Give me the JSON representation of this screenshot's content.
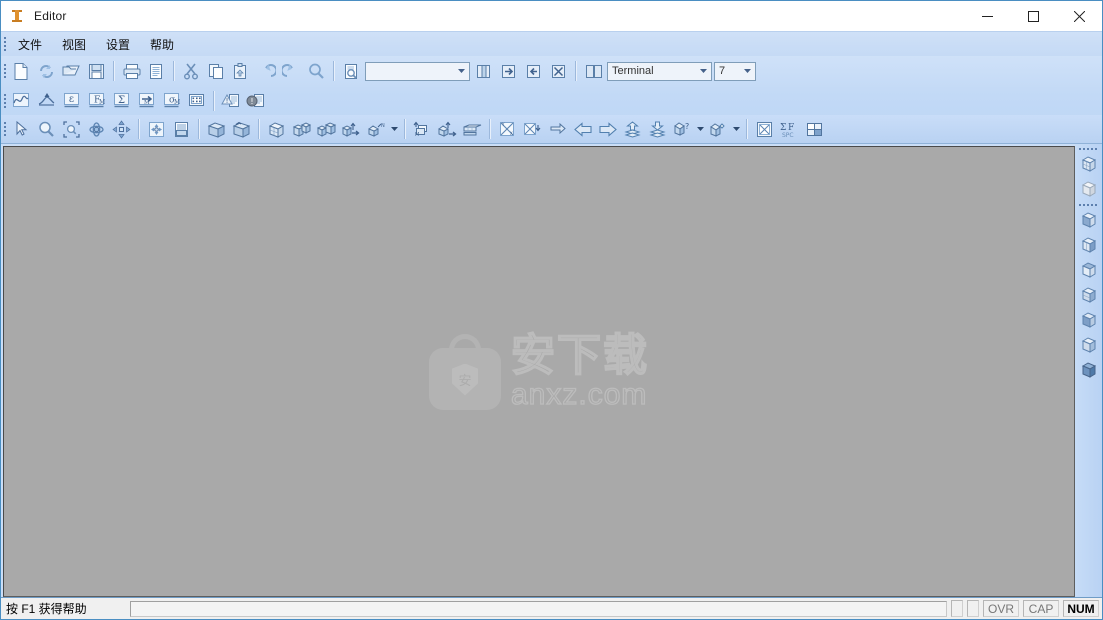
{
  "window": {
    "title": "Editor",
    "icon": "ibeam-icon",
    "controls": {
      "minimize": "minimize-icon",
      "maximize": "maximize-icon",
      "close": "close-icon"
    }
  },
  "menubar": {
    "items": [
      {
        "label": "文件",
        "name": "menu-file"
      },
      {
        "label": "视图",
        "name": "menu-view"
      },
      {
        "label": "设置",
        "name": "menu-settings"
      },
      {
        "label": "帮助",
        "name": "menu-help"
      }
    ]
  },
  "toolbars": {
    "row1": {
      "buttons": [
        {
          "name": "new-file-icon",
          "glyph": "doc"
        },
        {
          "name": "refresh-icon",
          "glyph": "refresh"
        },
        {
          "name": "open-folder-icon",
          "glyph": "folder"
        },
        {
          "name": "save-icon",
          "glyph": "save"
        },
        {
          "name": "print-icon",
          "glyph": "print"
        },
        {
          "name": "print-preview-icon",
          "glyph": "preview"
        },
        {
          "name": "cut-icon",
          "glyph": "cut"
        },
        {
          "name": "copy-icon",
          "glyph": "copy"
        },
        {
          "name": "paste-icon",
          "glyph": "paste"
        },
        {
          "name": "undo-icon",
          "glyph": "undo"
        },
        {
          "name": "redo-icon",
          "glyph": "redo"
        },
        {
          "name": "find-icon",
          "glyph": "find"
        },
        {
          "name": "find-in-file-icon",
          "glyph": "findfile"
        }
      ],
      "combo_blank": {
        "value": "",
        "placeholder": ""
      },
      "nav_buttons": [
        {
          "name": "bookmark-toggle-icon",
          "glyph": "bm1"
        },
        {
          "name": "bookmark-next-icon",
          "glyph": "bm2"
        },
        {
          "name": "bookmark-prev-icon",
          "glyph": "bm3"
        },
        {
          "name": "bookmark-clear-icon",
          "glyph": "bm4"
        }
      ],
      "split_button": {
        "name": "split-window-icon"
      },
      "font_name": "Terminal",
      "font_size": "7"
    },
    "row2": {
      "buttons": [
        {
          "name": "curve-plot-icon",
          "label": ""
        },
        {
          "name": "peak-curve-icon",
          "label": ""
        },
        {
          "name": "epsilon-icon",
          "label": "ε"
        },
        {
          "name": "force-moment-icon",
          "label": "F"
        },
        {
          "name": "sigma-sum-icon",
          "label": "Σ"
        },
        {
          "name": "moment-arrow-icon",
          "label": ""
        },
        {
          "name": "sigma-m-icon",
          "label": "σ"
        },
        {
          "name": "matrix-grid-icon",
          "label": ""
        },
        {
          "name": "warning-report-icon",
          "label": ""
        },
        {
          "name": "error-report-icon",
          "label": ""
        }
      ]
    },
    "row3": {
      "buttons": [
        {
          "name": "select-cursor-icon"
        },
        {
          "name": "zoom-icon"
        },
        {
          "name": "zoom-window-icon"
        },
        {
          "name": "rotate-icon"
        },
        {
          "name": "pan-icon"
        },
        {
          "name": "fit-view-icon"
        },
        {
          "name": "list-view-icon"
        },
        {
          "name": "solid-block-icon"
        },
        {
          "name": "extrude-block-icon"
        },
        {
          "name": "wire-block-icon"
        },
        {
          "name": "mesh-block-icon"
        },
        {
          "name": "assembly-block-icon"
        },
        {
          "name": "move-element-icon"
        },
        {
          "name": "transform-element-icon"
        },
        {
          "name": "group-copy-icon"
        },
        {
          "name": "extrude-arrow-icon"
        },
        {
          "name": "layer-stack-icon"
        },
        {
          "name": "plot-axes-icon"
        },
        {
          "name": "plot-result-icon"
        },
        {
          "name": "export-result-icon"
        },
        {
          "name": "previous-step-icon"
        },
        {
          "name": "next-step-icon"
        },
        {
          "name": "upload-result-icon"
        },
        {
          "name": "download-result-icon"
        },
        {
          "name": "query-entity-icon"
        },
        {
          "name": "create-entity-icon"
        },
        {
          "name": "graph-window-icon"
        },
        {
          "name": "sum-force-spc-icon"
        },
        {
          "name": "split-panel-icon"
        }
      ],
      "carets": [
        "entity-dropdown-caret",
        "create-dropdown-caret"
      ]
    }
  },
  "sidebar": {
    "group1": [
      {
        "name": "sidebar-wire-cube-icon"
      },
      {
        "name": "sidebar-solid-cube-icon"
      }
    ],
    "group2": [
      {
        "name": "sidebar-view-iso-icon"
      },
      {
        "name": "sidebar-view-front-icon"
      },
      {
        "name": "sidebar-view-top-icon"
      },
      {
        "name": "sidebar-view-right-icon"
      },
      {
        "name": "sidebar-view-back-icon"
      },
      {
        "name": "sidebar-view-left-icon"
      },
      {
        "name": "sidebar-view-shaded-icon"
      }
    ]
  },
  "canvas": {
    "watermark": {
      "logo_char": "安",
      "cn_text": "安下载",
      "en_text": "anxz.com"
    },
    "background_color": "#a9a9a9"
  },
  "statusbar": {
    "message": "按 F1 获得帮助",
    "indicators": [
      {
        "label": "OVR",
        "name": "status-ovr",
        "active": false
      },
      {
        "label": "CAP",
        "name": "status-cap",
        "active": false
      },
      {
        "label": "NUM",
        "name": "status-num",
        "active": true
      }
    ]
  },
  "colors": {
    "title_bar": "#ffffff",
    "menu_bar": "#c9dcf6",
    "toolbar": "#c2d9f6",
    "canvas": "#a9a9a9",
    "status_bar": "#f0f0f0",
    "accent_border": "#4a8ec2",
    "icon_orange": "#e0922f"
  }
}
